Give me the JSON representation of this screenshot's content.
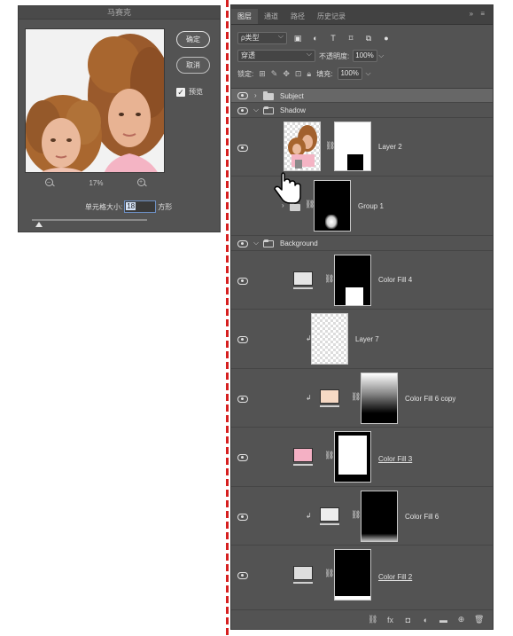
{
  "dialog": {
    "title": "马赛克",
    "ok_label": "确定",
    "cancel_label": "取消",
    "preview_label": "预览",
    "preview_checked": true,
    "zoom_level": "17%",
    "zoom_out_icon": "zoom-out-icon",
    "zoom_in_icon": "zoom-in-icon",
    "cell_size_label": "单元格大小:",
    "cell_size_value": "18",
    "cell_size_unit": "方形"
  },
  "panel": {
    "tabs": [
      "图层",
      "通道",
      "路径",
      "历史记录"
    ],
    "active_tab": 0,
    "menu_icons": "»  ≡",
    "filter_kind": "ρ类型",
    "blend_mode": "穿透",
    "opacity_label": "不透明度:",
    "opacity_value": "100%",
    "lock_label": "锁定:",
    "fill_label": "填充:",
    "fill_value": "100%"
  },
  "layers": [
    {
      "name": "Subject",
      "type": "group",
      "expanded": false,
      "selected": true
    },
    {
      "name": "Shadow",
      "type": "group",
      "expanded": true
    },
    {
      "name": "Layer 2",
      "type": "layer-with-mask"
    },
    {
      "name": "Group 1",
      "type": "group-with-mask"
    },
    {
      "name": "Background",
      "type": "group",
      "expanded": true
    },
    {
      "name": "Color Fill 4",
      "type": "fill",
      "color": "#e5e5e5"
    },
    {
      "name": "Layer 7",
      "type": "transparent-layer",
      "clipped": true
    },
    {
      "name": "Color Fill 6 copy",
      "type": "fill",
      "color": "#f6d9c4",
      "clipped": true
    },
    {
      "name": "Color Fill 3",
      "type": "fill",
      "color": "#f4b0c4"
    },
    {
      "name": "Color Fill 6",
      "type": "fill",
      "color": "#eeeeee",
      "clipped": true
    },
    {
      "name": "Color Fill 2",
      "type": "fill",
      "color": "#dddddd"
    }
  ]
}
